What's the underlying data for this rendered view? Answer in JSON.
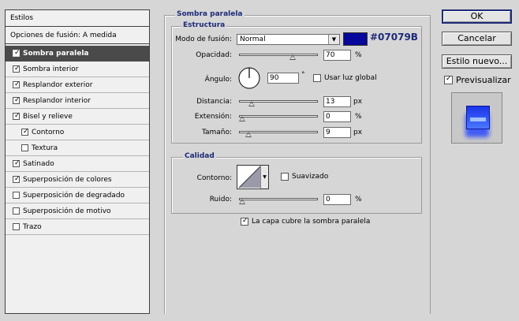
{
  "styles_panel": {
    "header": "Estilos",
    "blend_options": "Opciones de fusión: A medida",
    "items": [
      {
        "label": "Sombra paralela",
        "checked": true,
        "selected": true,
        "sub": false
      },
      {
        "label": "Sombra interior",
        "checked": true,
        "selected": false,
        "sub": false
      },
      {
        "label": "Resplandor exterior",
        "checked": true,
        "selected": false,
        "sub": false
      },
      {
        "label": "Resplandor interior",
        "checked": true,
        "selected": false,
        "sub": false
      },
      {
        "label": "Bisel y relieve",
        "checked": true,
        "selected": false,
        "sub": false
      },
      {
        "label": "Contorno",
        "checked": true,
        "selected": false,
        "sub": true
      },
      {
        "label": "Textura",
        "checked": false,
        "selected": false,
        "sub": true
      },
      {
        "label": "Satinado",
        "checked": true,
        "selected": false,
        "sub": false
      },
      {
        "label": "Superposición de colores",
        "checked": true,
        "selected": false,
        "sub": false
      },
      {
        "label": "Superposición de degradado",
        "checked": false,
        "selected": false,
        "sub": false
      },
      {
        "label": "Superposición de motivo",
        "checked": false,
        "selected": false,
        "sub": false
      },
      {
        "label": "Trazo",
        "checked": false,
        "selected": false,
        "sub": false
      }
    ]
  },
  "drop_shadow": {
    "title": "Sombra paralela",
    "structure": {
      "title": "Estructura",
      "blend_mode_label": "Modo de fusión:",
      "blend_mode_value": "Normal",
      "color_hex": "#07079B",
      "color_label": "#07079B",
      "opacity_label": "Opacidad:",
      "opacity_value": "70",
      "opacity_fraction": 0.7,
      "opacity_unit": "%",
      "angle_label": "Ángulo:",
      "angle_value": "90",
      "angle_unit": "°",
      "global_light_label": "Usar luz global",
      "global_light_checked": false,
      "distance_label": "Distancia:",
      "distance_value": "13",
      "distance_fraction": 0.13,
      "distance_unit": "px",
      "spread_label": "Extensión:",
      "spread_value": "0",
      "spread_fraction": 0.0,
      "spread_unit": "%",
      "size_label": "Tamaño:",
      "size_value": "9",
      "size_fraction": 0.09,
      "size_unit": "px"
    },
    "quality": {
      "title": "Calidad",
      "contour_label": "Contorno:",
      "antialias_label": "Suavizado",
      "antialias_checked": false,
      "noise_label": "Ruido:",
      "noise_value": "0",
      "noise_fraction": 0.0,
      "noise_unit": "%"
    },
    "knockout_label": "La capa cubre la sombra paralela",
    "knockout_checked": true
  },
  "buttons": {
    "ok": "OK",
    "cancel": "Cancelar",
    "new_style": "Estilo nuevo...",
    "preview_label": "Previsualizar",
    "preview_checked": true
  },
  "colors": {
    "accent": "#1d2a78",
    "shadow_color": "#07079B"
  }
}
